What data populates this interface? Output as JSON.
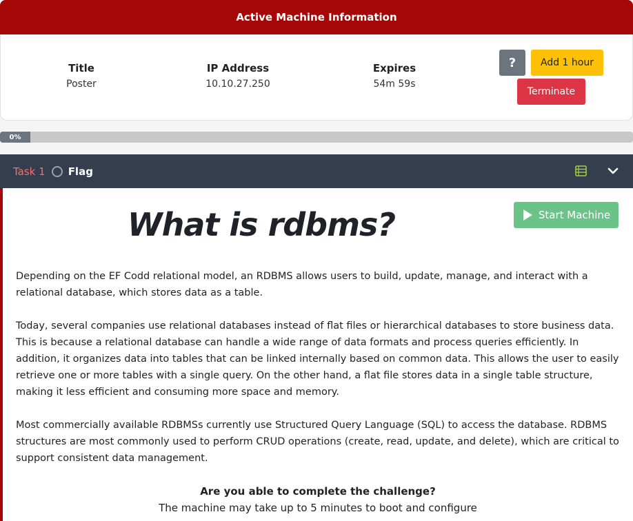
{
  "machine": {
    "header_title": "Active Machine Information",
    "title_label": "Title",
    "title_value": "Poster",
    "ip_label": "IP Address",
    "ip_value": "10.10.27.250",
    "expires_label": "Expires",
    "expires_value": "54m 59s",
    "help_label": "?",
    "add_hour_label": "Add 1 hour",
    "terminate_label": "Terminate"
  },
  "progress": {
    "percent": 0,
    "label": "0%"
  },
  "task": {
    "number_label": "Task 1",
    "title": "Flag",
    "start_machine_label": "Start Machine",
    "heading": "What is rdbms?",
    "paragraphs": [
      "Depending on the EF Codd relational model, an RDBMS allows users to build, update, manage, and interact with a relational database, which stores data as a table.",
      "Today, several companies use relational databases instead of flat files or hierarchical databases to store business data. This is because a relational database can handle a wide range of data formats and process queries efficiently. In addition, it organizes data into tables that can be linked internally based on common data. This allows the user to easily retrieve one or more tables with a single query. On the other hand, a flat file stores data in a single table structure, making it less efficient and consuming more space and memory.",
      "Most commercially available RDBMSs currently use Structured Query Language (SQL) to access the database. RDBMS structures are most commonly used to perform CRUD operations (create, read, update, and delete), which are critical to support consistent data management."
    ],
    "question": "Are you able to complete the challenge?",
    "boot_note": "The machine may take up to 5 minutes to boot and configure"
  },
  "colors": {
    "header_red": "#a50606",
    "task_bar": "#353e4f",
    "add_hour": "#ffc107",
    "terminate": "#dc3545",
    "start_machine": "#6cc38a",
    "task_number": "#f86d6d"
  },
  "icons": [
    "question-icon",
    "circle-icon",
    "notes-icon",
    "chevron-down-icon",
    "play-icon"
  ]
}
